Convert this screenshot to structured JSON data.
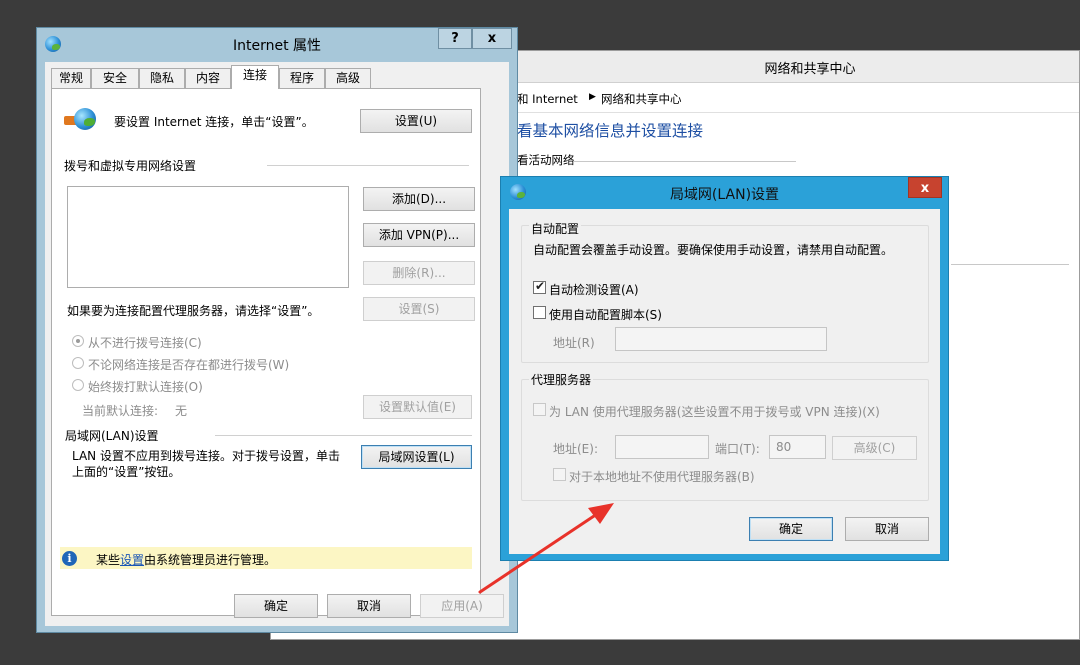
{
  "network_center": {
    "title": "网络和共享中心",
    "breadcrumb": [
      "和 Internet",
      "网络和共享中心"
    ],
    "heading": "看基本网络信息并设置连接",
    "active_networks": "看活动网络"
  },
  "inet": {
    "title": "Internet 属性",
    "help": "?",
    "close": "x",
    "tabs": [
      "常规",
      "安全",
      "隐私",
      "内容",
      "连接",
      "程序",
      "高级"
    ],
    "setup_text": "要设置 Internet 连接，单击“设置”。",
    "setup_btn": "设置(U)",
    "dialup_section": "拨号和虚拟专用网络设置",
    "add_btn": "添加(D)...",
    "add_vpn_btn": "添加 VPN(P)...",
    "remove_btn": "删除(R)...",
    "proxy_hint": "如果要为连接配置代理服务器，请选择“设置”。",
    "settings_btn": "设置(S)",
    "radio_never": "从不进行拨号连接(C)",
    "radio_whenever": "不论网络连接是否存在都进行拨号(W)",
    "radio_always": "始终拨打默认连接(O)",
    "current_default_label": "当前默认连接:",
    "current_default_value": "无",
    "set_default_btn": "设置默认值(E)",
    "lan_section": "局域网(LAN)设置",
    "lan_text_1": "LAN 设置不应用到拨号连接。对于拨号设置，单击",
    "lan_text_2": "上面的“设置”按钮。",
    "lan_btn": "局域网设置(L)",
    "info_prefix": "某些",
    "info_link": "设置",
    "info_suffix": "由系统管理员进行管理。",
    "ok": "确定",
    "cancel": "取消",
    "apply": "应用(A)"
  },
  "lan": {
    "title": "局域网(LAN)设置",
    "close": "x",
    "auto_section": "自动配置",
    "auto_desc": "自动配置会覆盖手动设置。要确保使用手动设置，请禁用自动配置。",
    "auto_detect": "自动检测设置(A)",
    "auto_detect_checked": true,
    "use_script": "使用自动配置脚本(S)",
    "use_script_checked": false,
    "address_label": "地址(R)",
    "proxy_section": "代理服务器",
    "use_proxy": "为 LAN 使用代理服务器(这些设置不用于拨号或 VPN 连接)(X)",
    "proxy_address_label": "地址(E):",
    "port_label": "端口(T):",
    "port_value": "80",
    "advanced_btn": "高级(C)",
    "bypass_local": "对于本地地址不使用代理服务器(B)",
    "ok": "确定",
    "cancel": "取消"
  },
  "colors": {
    "inet_frame": "#a7c7d9",
    "lan_frame": "#2ba1d8",
    "close_red": "#c7432f",
    "arrow_red": "#e8322a",
    "link_blue": "#1a55b5"
  }
}
